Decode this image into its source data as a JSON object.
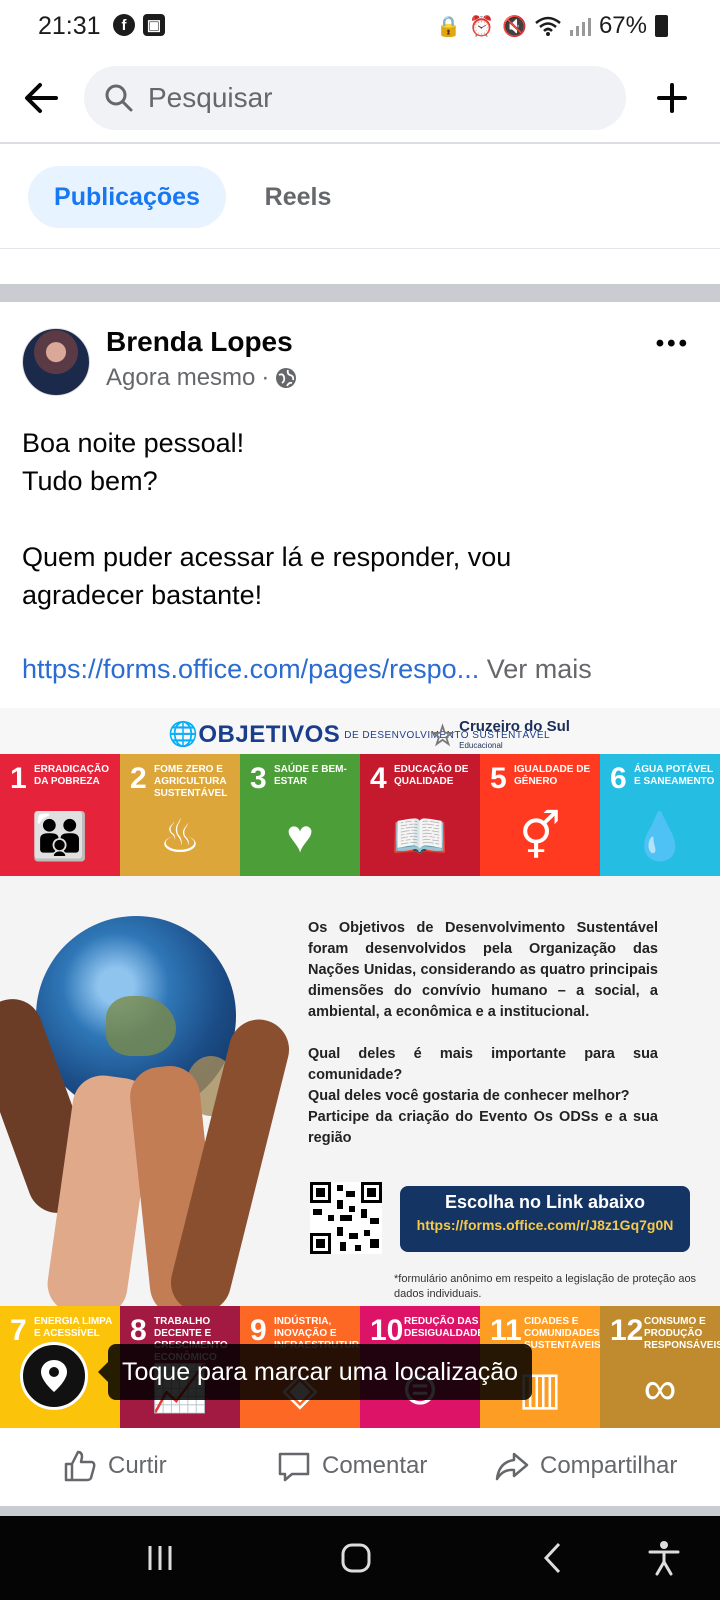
{
  "status_bar": {
    "time": "21:31",
    "battery": "67%",
    "left_icons": [
      "facebook-icon",
      "gallery-icon"
    ],
    "right_icons": [
      "lock-icon",
      "alarm-icon",
      "mute-icon",
      "wifi-icon",
      "signal-icon",
      "battery-icon"
    ]
  },
  "search": {
    "placeholder": "Pesquisar"
  },
  "tabs": [
    {
      "label": "Publicações",
      "active": true
    },
    {
      "label": "Reels",
      "active": false
    }
  ],
  "post": {
    "author": "Brenda Lopes",
    "time": "Agora mesmo",
    "separator": "·",
    "privacy_icon": "globe-icon",
    "lines": [
      "Boa noite pessoal!",
      "Tudo bem?",
      "",
      "Quem puder acessar lá e responder, vou",
      "agradecer bastante!"
    ],
    "link": "https://forms.office.com/pages/respo...",
    "see_more": "Ver mais"
  },
  "poster": {
    "brand": "OBJETIVOS",
    "brand_sub": "DE DESENVOLVIMENTO SUSTENTÁVEL",
    "partner": "Cruzeiro do Sul",
    "partner_sub": "Educacional",
    "goals_top": [
      {
        "num": "1",
        "label": "Erradicação da pobreza",
        "color": "#e5243b",
        "glyph": "👪"
      },
      {
        "num": "2",
        "label": "Fome zero e agricultura sustentável",
        "color": "#dda63a",
        "glyph": "♨"
      },
      {
        "num": "3",
        "label": "Saúde e bem-estar",
        "color": "#4c9f38",
        "glyph": "♥"
      },
      {
        "num": "4",
        "label": "Educação de qualidade",
        "color": "#c5192d",
        "glyph": "📖"
      },
      {
        "num": "5",
        "label": "Igualdade de gênero",
        "color": "#ff3a21",
        "glyph": "⚥"
      },
      {
        "num": "6",
        "label": "Água potável e saneamento",
        "color": "#26bde2",
        "glyph": "💧"
      }
    ],
    "goals_bottom": [
      {
        "num": "7",
        "label": "Energia limpa e acessível",
        "color": "#fcc30b",
        "glyph": "☀"
      },
      {
        "num": "8",
        "label": "Trabalho decente e crescimento econômico",
        "color": "#a21942",
        "glyph": "📈"
      },
      {
        "num": "9",
        "label": "Indústria, inovação e infraestrutura",
        "color": "#fd6925",
        "glyph": "◈"
      },
      {
        "num": "10",
        "label": "Redução das desigualdades",
        "color": "#dd1367",
        "glyph": "⊜"
      },
      {
        "num": "11",
        "label": "Cidades e comunidades sustentáveis",
        "color": "#fd9d24",
        "glyph": "▥"
      },
      {
        "num": "12",
        "label": "Consumo e produção responsáveis",
        "color": "#bf8b2e",
        "glyph": "∞"
      }
    ],
    "body_paragraph_1": "Os Objetivos de Desenvolvimento Sustentável foram desenvolvidos pela Organização das Nações Unidas, considerando as quatro principais dimensões do convívio humano – a social, a ambiental, a econômica e a institucional.",
    "body_paragraph_2": "Qual deles é mais importante para sua comunidade?",
    "body_paragraph_3": "Qual deles você gostaria de conhecer melhor?",
    "body_paragraph_4": "Participe da criação do Evento Os ODSs e a sua região",
    "link_box_title": "Escolha no Link abaixo",
    "link_box_url": "https://forms.office.com/r/J8z1Gq7g0N",
    "footnote": "*formulário anônimo em respeito a legislação de proteção aos dados individuais."
  },
  "location_tooltip": "Toque para marcar uma localização",
  "actions": {
    "like": "Curtir",
    "comment": "Comentar",
    "share": "Compartilhar"
  },
  "colors": {
    "facebook_blue": "#1877f2",
    "tab_active_bg": "#e7f3ff",
    "link_blue": "#2a6cd0",
    "secondary_text": "#65676b"
  }
}
